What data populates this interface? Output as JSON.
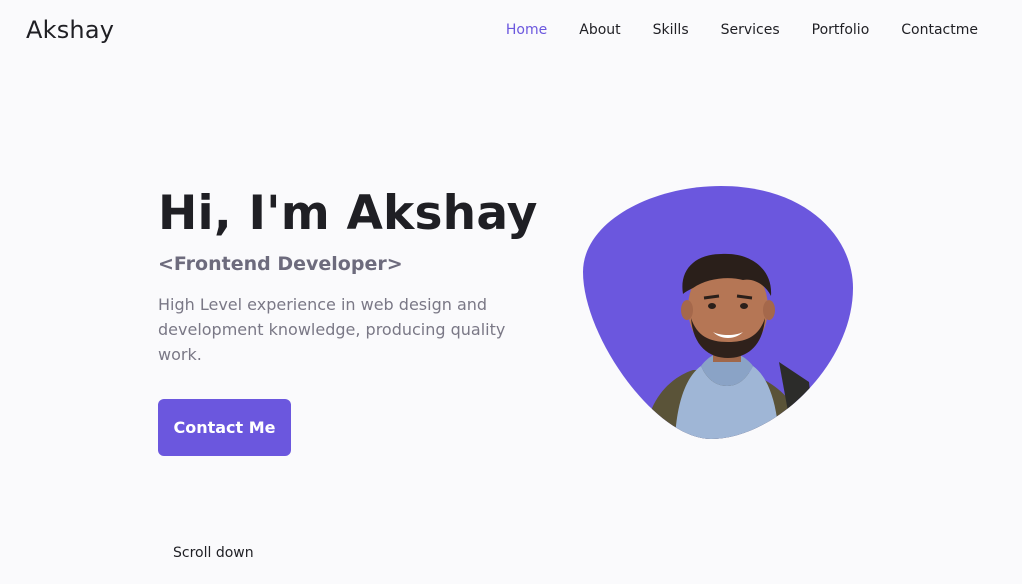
{
  "header": {
    "brand": "Akshay",
    "nav": [
      {
        "label": "Home",
        "active": true
      },
      {
        "label": "About",
        "active": false
      },
      {
        "label": "Skills",
        "active": false
      },
      {
        "label": "Services",
        "active": false
      },
      {
        "label": "Portfolio",
        "active": false
      },
      {
        "label": "Contactme",
        "active": false
      }
    ]
  },
  "hero": {
    "title": "Hi, I'm Akshay",
    "subtitle": "<Frontend Developer>",
    "description": "High Level experience in web design and development knowledge, producing quality work.",
    "cta_label": "Contact Me",
    "scroll_label": "Scroll down"
  },
  "colors": {
    "accent": "#6b57de",
    "background": "#fafafc",
    "text": "#1f1f24",
    "muted": "#6d6b7d"
  },
  "icons": {
    "avatar": "profile-photo"
  }
}
